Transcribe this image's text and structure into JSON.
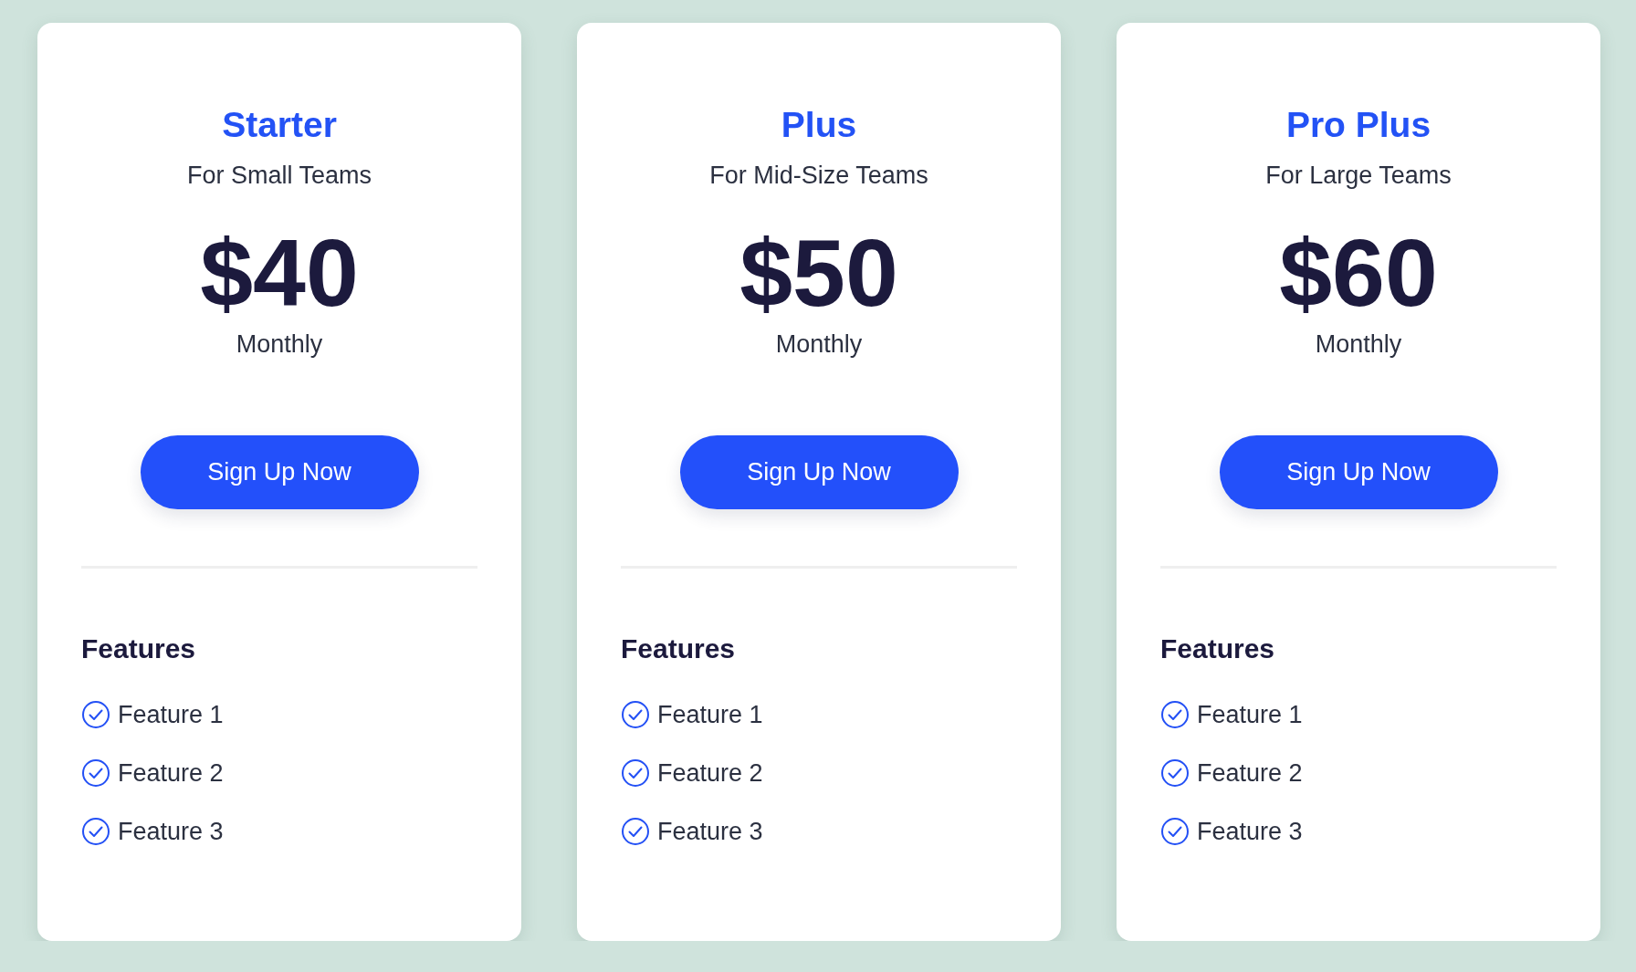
{
  "plans": [
    {
      "name": "Starter",
      "audience": "For Small Teams",
      "price": "$40",
      "period": "Monthly",
      "button": "Sign Up Now",
      "features_heading": "Features",
      "features": [
        "Feature 1",
        "Feature 2",
        "Feature 3"
      ]
    },
    {
      "name": "Plus",
      "audience": "For Mid-Size Teams",
      "price": "$50",
      "period": "Monthly",
      "button": "Sign Up Now",
      "features_heading": "Features",
      "features": [
        "Feature 1",
        "Feature 2",
        "Feature 3"
      ]
    },
    {
      "name": "Pro Plus",
      "audience": "For Large Teams",
      "price": "$60",
      "period": "Monthly",
      "button": "Sign Up Now",
      "features_heading": "Features",
      "features": [
        "Feature 1",
        "Feature 2",
        "Feature 3"
      ]
    }
  ]
}
